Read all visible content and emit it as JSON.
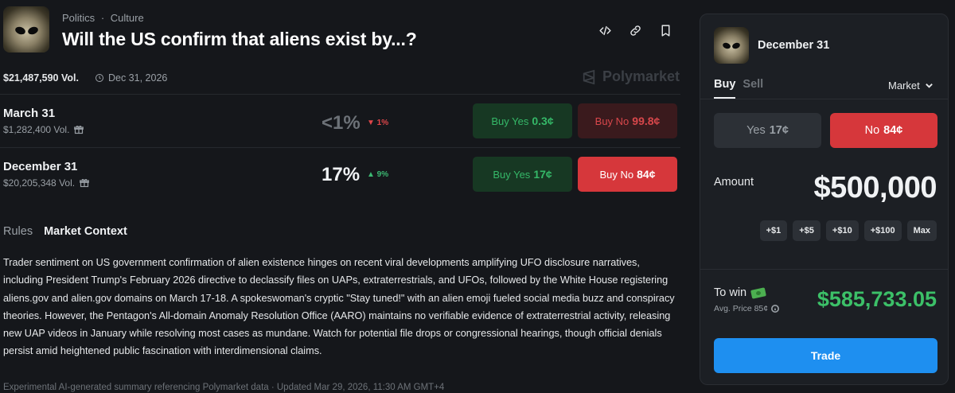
{
  "header": {
    "category_1": "Politics",
    "separator": "·",
    "category_2": "Culture",
    "title": "Will the US confirm that aliens exist by...?",
    "volume": "$21,487,590 Vol.",
    "end_date": "Dec 31, 2026",
    "brand": "Polymarket",
    "icons": [
      "embed-icon",
      "link-icon",
      "bookmark-icon",
      "clock-icon"
    ]
  },
  "markets": [
    {
      "name": "March 31",
      "volume": "$1,282,400 Vol.",
      "probability": "<1%",
      "change": "▼ 1%",
      "yes_label": "Buy Yes",
      "yes_price": "0.3¢",
      "no_label": "Buy No",
      "no_price": "99.8¢"
    },
    {
      "name": "December 31",
      "volume": "$20,205,348 Vol.",
      "probability": "17%",
      "change": "▲ 9%",
      "yes_label": "Buy Yes",
      "yes_price": "17¢",
      "no_label": "Buy No",
      "no_price": "84¢"
    }
  ],
  "context": {
    "tab_rules": "Rules",
    "tab_market_context": "Market Context",
    "summary": "Trader sentiment on US government confirmation of alien existence hinges on recent viral developments amplifying UFO disclosure narratives, including President Trump's February 2026 directive to declassify files on UAPs, extraterrestrials, and UFOs, followed by the White House registering aliens.gov and alien.gov domains on March 17-18. A spokeswoman's cryptic \"Stay tuned!\" with an alien emoji fueled social media buzz and conspiracy theories. However, the Pentagon's All-domain Anomaly Resolution Office (AARO) maintains no verifiable evidence of extraterrestrial activity, releasing new UAP videos in January while resolving most cases as mundane. Watch for potential file drops or congressional hearings, though official denials persist amid heightened public fascination with interdimensional claims.",
    "footnote": "Experimental AI-generated summary referencing Polymarket data · Updated Mar 29, 2026, 11:30 AM GMT+4"
  },
  "panel": {
    "title": "December 31",
    "tab_buy": "Buy",
    "tab_sell": "Sell",
    "order_type": "Market",
    "yes_label": "Yes",
    "yes_price": "17¢",
    "no_label": "No",
    "no_price": "84¢",
    "amount_label": "Amount",
    "amount_value": "$500,000",
    "quick_amounts": [
      "+$1",
      "+$5",
      "+$10",
      "+$100",
      "Max"
    ],
    "to_win_label": "To win",
    "avg_price": "Avg. Price 85¢",
    "to_win_value": "$585,733.05",
    "trade_label": "Trade"
  },
  "colors": {
    "background": "#15171b",
    "panel": "#1c1f24",
    "yes_green": "#35b868",
    "no_red": "#d6373b",
    "trade_blue": "#1e8ff0"
  }
}
